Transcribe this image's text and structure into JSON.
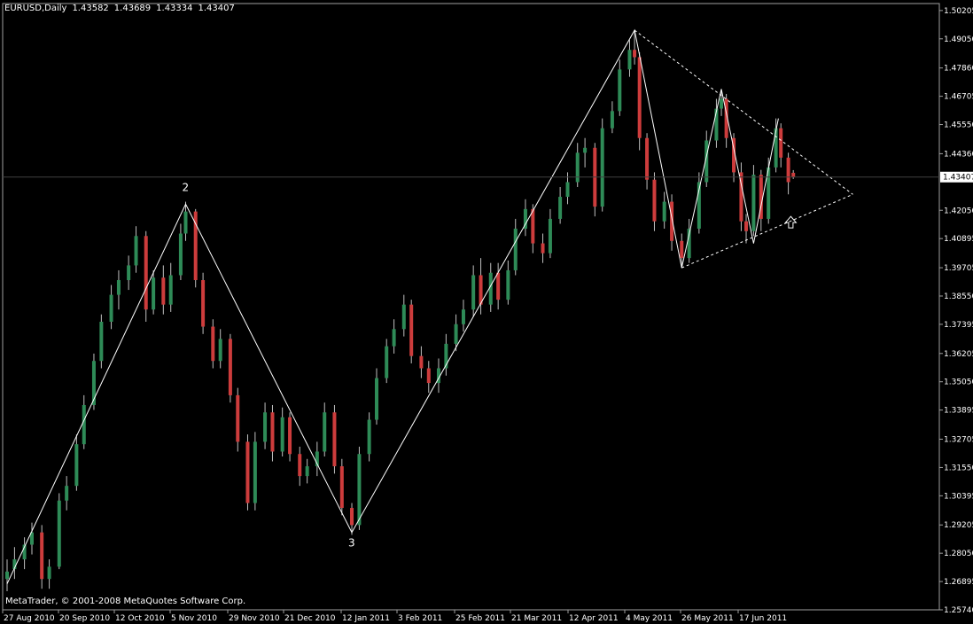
{
  "header": {
    "symbol": "EURUSD,Daily",
    "open": "1.43582",
    "high": "1.43689",
    "low": "1.43334",
    "close": "1.43407"
  },
  "copyright": "MetaTrader, © 2001-2008 MetaQuotes Software Corp.",
  "colors": {
    "background": "#000000",
    "bull": "#2e8b57",
    "bear": "#cd3c3c",
    "wick": "#c0c0c0",
    "lines": "#ffffff",
    "price_tag_bg": "#ffffff",
    "price_tag_text": "#000000",
    "axis_text": "#ffffff"
  },
  "chart_data": {
    "type": "candlestick",
    "title": "",
    "xlabel": "",
    "ylabel": "",
    "ylim": [
      1.2574,
      1.5049
    ],
    "y_ticks": [
      "1.50205",
      "1.49050",
      "1.47860",
      "1.46705",
      "1.45550",
      "1.44360",
      "1.43407",
      "1.42050",
      "1.40895",
      "1.39705",
      "1.38550",
      "1.37395",
      "1.36205",
      "1.35050",
      "1.33895",
      "1.32705",
      "1.31550",
      "1.30395",
      "1.29205",
      "1.28050",
      "1.26895",
      "1.25740"
    ],
    "x_ticks": [
      "27 Aug 2010",
      "20 Sep 2010",
      "12 Oct 2010",
      "5 Nov 2010",
      "29 Nov 2010",
      "21 Dec 2010",
      "12 Jan 2011",
      "3 Feb 2011",
      "25 Feb 2011",
      "21 Mar 2011",
      "12 Apr 2011",
      "4 May 2011",
      "26 May 2011",
      "17 Jun 2011"
    ],
    "x_domain": [
      "2010-08-24",
      "2011-07-08"
    ],
    "current_price": "1.43407",
    "grid": false,
    "wave_labels": [
      {
        "text": "2",
        "date": "2010-11-04",
        "price": 1.424
      },
      {
        "text": "3",
        "date": "2011-01-10",
        "price": 1.289
      }
    ],
    "wave_lines": [
      {
        "style": "solid",
        "points": [
          [
            "2010-08-24",
            1.268
          ],
          [
            "2010-11-04",
            1.423
          ],
          [
            "2011-01-10",
            1.289
          ],
          [
            "2011-05-04",
            1.494
          ],
          [
            "2011-05-23",
            1.397
          ],
          [
            "2011-06-08",
            1.47
          ],
          [
            "2011-06-21",
            1.407
          ],
          [
            "2011-07-01",
            1.458
          ]
        ]
      },
      {
        "style": "dashed",
        "points": [
          [
            "2011-05-04",
            1.494
          ],
          [
            "2011-07-31",
            1.427
          ]
        ]
      },
      {
        "style": "dashed",
        "points": [
          [
            "2011-05-23",
            1.397
          ],
          [
            "2011-07-31",
            1.427
          ]
        ]
      }
    ],
    "arrow_marker": {
      "date": "2011-07-06",
      "price": 1.418,
      "direction": "up"
    },
    "candles": [
      {
        "date": "2010-08-24",
        "o": 1.27,
        "h": 1.278,
        "l": 1.265,
        "c": 1.273
      },
      {
        "date": "2010-08-27",
        "o": 1.274,
        "h": 1.283,
        "l": 1.27,
        "c": 1.278
      },
      {
        "date": "2010-08-31",
        "o": 1.278,
        "h": 1.287,
        "l": 1.274,
        "c": 1.284
      },
      {
        "date": "2010-09-03",
        "o": 1.284,
        "h": 1.293,
        "l": 1.28,
        "c": 1.289
      },
      {
        "date": "2010-09-07",
        "o": 1.289,
        "h": 1.292,
        "l": 1.266,
        "c": 1.27
      },
      {
        "date": "2010-09-10",
        "o": 1.27,
        "h": 1.278,
        "l": 1.266,
        "c": 1.275
      },
      {
        "date": "2010-09-14",
        "o": 1.275,
        "h": 1.305,
        "l": 1.274,
        "c": 1.302
      },
      {
        "date": "2010-09-17",
        "o": 1.302,
        "h": 1.312,
        "l": 1.298,
        "c": 1.308
      },
      {
        "date": "2010-09-21",
        "o": 1.308,
        "h": 1.329,
        "l": 1.306,
        "c": 1.325
      },
      {
        "date": "2010-09-24",
        "o": 1.325,
        "h": 1.345,
        "l": 1.323,
        "c": 1.341
      },
      {
        "date": "2010-09-28",
        "o": 1.341,
        "h": 1.362,
        "l": 1.339,
        "c": 1.359
      },
      {
        "date": "2010-10-01",
        "o": 1.359,
        "h": 1.378,
        "l": 1.356,
        "c": 1.375
      },
      {
        "date": "2010-10-05",
        "o": 1.375,
        "h": 1.39,
        "l": 1.372,
        "c": 1.386
      },
      {
        "date": "2010-10-08",
        "o": 1.386,
        "h": 1.396,
        "l": 1.38,
        "c": 1.392
      },
      {
        "date": "2010-10-12",
        "o": 1.392,
        "h": 1.402,
        "l": 1.388,
        "c": 1.398
      },
      {
        "date": "2010-10-15",
        "o": 1.398,
        "h": 1.414,
        "l": 1.395,
        "c": 1.41
      },
      {
        "date": "2010-10-19",
        "o": 1.41,
        "h": 1.412,
        "l": 1.375,
        "c": 1.38
      },
      {
        "date": "2010-10-22",
        "o": 1.38,
        "h": 1.396,
        "l": 1.378,
        "c": 1.393
      },
      {
        "date": "2010-10-26",
        "o": 1.393,
        "h": 1.398,
        "l": 1.378,
        "c": 1.382
      },
      {
        "date": "2010-10-29",
        "o": 1.382,
        "h": 1.399,
        "l": 1.379,
        "c": 1.394
      },
      {
        "date": "2010-11-02",
        "o": 1.394,
        "h": 1.415,
        "l": 1.392,
        "c": 1.411
      },
      {
        "date": "2010-11-04",
        "o": 1.411,
        "h": 1.424,
        "l": 1.408,
        "c": 1.42
      },
      {
        "date": "2010-11-08",
        "o": 1.42,
        "h": 1.421,
        "l": 1.389,
        "c": 1.392
      },
      {
        "date": "2010-11-11",
        "o": 1.392,
        "h": 1.395,
        "l": 1.37,
        "c": 1.373
      },
      {
        "date": "2010-11-15",
        "o": 1.373,
        "h": 1.376,
        "l": 1.356,
        "c": 1.359
      },
      {
        "date": "2010-11-18",
        "o": 1.359,
        "h": 1.372,
        "l": 1.356,
        "c": 1.368
      },
      {
        "date": "2010-11-22",
        "o": 1.368,
        "h": 1.37,
        "l": 1.342,
        "c": 1.345
      },
      {
        "date": "2010-11-25",
        "o": 1.345,
        "h": 1.348,
        "l": 1.322,
        "c": 1.326
      },
      {
        "date": "2010-11-29",
        "o": 1.326,
        "h": 1.329,
        "l": 1.298,
        "c": 1.301
      },
      {
        "date": "2010-12-02",
        "o": 1.301,
        "h": 1.33,
        "l": 1.298,
        "c": 1.326
      },
      {
        "date": "2010-12-06",
        "o": 1.326,
        "h": 1.342,
        "l": 1.323,
        "c": 1.338
      },
      {
        "date": "2010-12-09",
        "o": 1.338,
        "h": 1.341,
        "l": 1.318,
        "c": 1.322
      },
      {
        "date": "2010-12-13",
        "o": 1.322,
        "h": 1.34,
        "l": 1.32,
        "c": 1.336
      },
      {
        "date": "2010-12-16",
        "o": 1.336,
        "h": 1.338,
        "l": 1.318,
        "c": 1.321
      },
      {
        "date": "2010-12-20",
        "o": 1.321,
        "h": 1.324,
        "l": 1.308,
        "c": 1.312
      },
      {
        "date": "2010-12-23",
        "o": 1.312,
        "h": 1.319,
        "l": 1.309,
        "c": 1.316
      },
      {
        "date": "2010-12-27",
        "o": 1.316,
        "h": 1.326,
        "l": 1.312,
        "c": 1.322
      },
      {
        "date": "2010-12-30",
        "o": 1.322,
        "h": 1.342,
        "l": 1.32,
        "c": 1.338
      },
      {
        "date": "2011-01-03",
        "o": 1.338,
        "h": 1.341,
        "l": 1.313,
        "c": 1.316
      },
      {
        "date": "2011-01-06",
        "o": 1.316,
        "h": 1.319,
        "l": 1.296,
        "c": 1.299
      },
      {
        "date": "2011-01-10",
        "o": 1.299,
        "h": 1.301,
        "l": 1.288,
        "c": 1.292
      },
      {
        "date": "2011-01-13",
        "o": 1.292,
        "h": 1.324,
        "l": 1.29,
        "c": 1.321
      },
      {
        "date": "2011-01-17",
        "o": 1.321,
        "h": 1.338,
        "l": 1.318,
        "c": 1.335
      },
      {
        "date": "2011-01-20",
        "o": 1.335,
        "h": 1.356,
        "l": 1.333,
        "c": 1.352
      },
      {
        "date": "2011-01-24",
        "o": 1.352,
        "h": 1.368,
        "l": 1.35,
        "c": 1.365
      },
      {
        "date": "2011-01-27",
        "o": 1.365,
        "h": 1.376,
        "l": 1.362,
        "c": 1.372
      },
      {
        "date": "2011-01-31",
        "o": 1.372,
        "h": 1.386,
        "l": 1.369,
        "c": 1.382
      },
      {
        "date": "2011-02-03",
        "o": 1.382,
        "h": 1.384,
        "l": 1.358,
        "c": 1.361
      },
      {
        "date": "2011-02-07",
        "o": 1.361,
        "h": 1.365,
        "l": 1.352,
        "c": 1.356
      },
      {
        "date": "2011-02-10",
        "o": 1.356,
        "h": 1.359,
        "l": 1.346,
        "c": 1.35
      },
      {
        "date": "2011-02-14",
        "o": 1.35,
        "h": 1.36,
        "l": 1.346,
        "c": 1.356
      },
      {
        "date": "2011-02-17",
        "o": 1.356,
        "h": 1.37,
        "l": 1.353,
        "c": 1.366
      },
      {
        "date": "2011-02-21",
        "o": 1.366,
        "h": 1.378,
        "l": 1.363,
        "c": 1.374
      },
      {
        "date": "2011-02-24",
        "o": 1.374,
        "h": 1.384,
        "l": 1.371,
        "c": 1.38
      },
      {
        "date": "2011-02-28",
        "o": 1.38,
        "h": 1.398,
        "l": 1.377,
        "c": 1.394
      },
      {
        "date": "2011-03-03",
        "o": 1.394,
        "h": 1.401,
        "l": 1.378,
        "c": 1.382
      },
      {
        "date": "2011-03-07",
        "o": 1.382,
        "h": 1.399,
        "l": 1.379,
        "c": 1.395
      },
      {
        "date": "2011-03-10",
        "o": 1.395,
        "h": 1.399,
        "l": 1.38,
        "c": 1.384
      },
      {
        "date": "2011-03-14",
        "o": 1.384,
        "h": 1.4,
        "l": 1.382,
        "c": 1.396
      },
      {
        "date": "2011-03-17",
        "o": 1.396,
        "h": 1.417,
        "l": 1.394,
        "c": 1.413
      },
      {
        "date": "2011-03-21",
        "o": 1.413,
        "h": 1.425,
        "l": 1.41,
        "c": 1.421
      },
      {
        "date": "2011-03-24",
        "o": 1.421,
        "h": 1.423,
        "l": 1.403,
        "c": 1.407
      },
      {
        "date": "2011-03-28",
        "o": 1.407,
        "h": 1.411,
        "l": 1.399,
        "c": 1.403
      },
      {
        "date": "2011-03-31",
        "o": 1.403,
        "h": 1.421,
        "l": 1.401,
        "c": 1.417
      },
      {
        "date": "2011-04-04",
        "o": 1.417,
        "h": 1.43,
        "l": 1.415,
        "c": 1.426
      },
      {
        "date": "2011-04-07",
        "o": 1.426,
        "h": 1.436,
        "l": 1.423,
        "c": 1.432
      },
      {
        "date": "2011-04-11",
        "o": 1.432,
        "h": 1.448,
        "l": 1.43,
        "c": 1.444
      },
      {
        "date": "2011-04-14",
        "o": 1.444,
        "h": 1.45,
        "l": 1.438,
        "c": 1.446
      },
      {
        "date": "2011-04-18",
        "o": 1.446,
        "h": 1.448,
        "l": 1.418,
        "c": 1.422
      },
      {
        "date": "2011-04-21",
        "o": 1.422,
        "h": 1.458,
        "l": 1.42,
        "c": 1.454
      },
      {
        "date": "2011-04-25",
        "o": 1.454,
        "h": 1.465,
        "l": 1.452,
        "c": 1.461
      },
      {
        "date": "2011-04-28",
        "o": 1.461,
        "h": 1.482,
        "l": 1.459,
        "c": 1.478
      },
      {
        "date": "2011-05-02",
        "o": 1.478,
        "h": 1.49,
        "l": 1.475,
        "c": 1.486
      },
      {
        "date": "2011-05-04",
        "o": 1.486,
        "h": 1.494,
        "l": 1.48,
        "c": 1.483
      },
      {
        "date": "2011-05-06",
        "o": 1.483,
        "h": 1.485,
        "l": 1.445,
        "c": 1.45
      },
      {
        "date": "2011-05-09",
        "o": 1.45,
        "h": 1.452,
        "l": 1.429,
        "c": 1.433
      },
      {
        "date": "2011-05-12",
        "o": 1.433,
        "h": 1.436,
        "l": 1.412,
        "c": 1.416
      },
      {
        "date": "2011-05-16",
        "o": 1.416,
        "h": 1.428,
        "l": 1.413,
        "c": 1.424
      },
      {
        "date": "2011-05-19",
        "o": 1.424,
        "h": 1.427,
        "l": 1.404,
        "c": 1.408
      },
      {
        "date": "2011-05-23",
        "o": 1.408,
        "h": 1.411,
        "l": 1.397,
        "c": 1.401
      },
      {
        "date": "2011-05-26",
        "o": 1.401,
        "h": 1.417,
        "l": 1.399,
        "c": 1.413
      },
      {
        "date": "2011-05-30",
        "o": 1.413,
        "h": 1.436,
        "l": 1.411,
        "c": 1.432
      },
      {
        "date": "2011-06-02",
        "o": 1.432,
        "h": 1.453,
        "l": 1.43,
        "c": 1.449
      },
      {
        "date": "2011-06-06",
        "o": 1.449,
        "h": 1.466,
        "l": 1.446,
        "c": 1.462
      },
      {
        "date": "2011-06-08",
        "o": 1.462,
        "h": 1.47,
        "l": 1.459,
        "c": 1.466
      },
      {
        "date": "2011-06-10",
        "o": 1.466,
        "h": 1.468,
        "l": 1.446,
        "c": 1.45
      },
      {
        "date": "2011-06-13",
        "o": 1.45,
        "h": 1.452,
        "l": 1.432,
        "c": 1.436
      },
      {
        "date": "2011-06-16",
        "o": 1.436,
        "h": 1.44,
        "l": 1.412,
        "c": 1.416
      },
      {
        "date": "2011-06-18",
        "o": 1.416,
        "h": 1.419,
        "l": 1.407,
        "c": 1.412
      },
      {
        "date": "2011-06-21",
        "o": 1.412,
        "h": 1.439,
        "l": 1.41,
        "c": 1.435
      },
      {
        "date": "2011-06-24",
        "o": 1.435,
        "h": 1.437,
        "l": 1.412,
        "c": 1.417
      },
      {
        "date": "2011-06-27",
        "o": 1.417,
        "h": 1.442,
        "l": 1.415,
        "c": 1.438
      },
      {
        "date": "2011-06-30",
        "o": 1.438,
        "h": 1.458,
        "l": 1.436,
        "c": 1.454
      },
      {
        "date": "2011-07-02",
        "o": 1.454,
        "h": 1.456,
        "l": 1.438,
        "c": 1.442
      },
      {
        "date": "2011-07-05",
        "o": 1.442,
        "h": 1.444,
        "l": 1.427,
        "c": 1.432
      },
      {
        "date": "2011-07-07",
        "o": 1.4358,
        "h": 1.4369,
        "l": 1.4333,
        "c": 1.4341
      }
    ]
  }
}
